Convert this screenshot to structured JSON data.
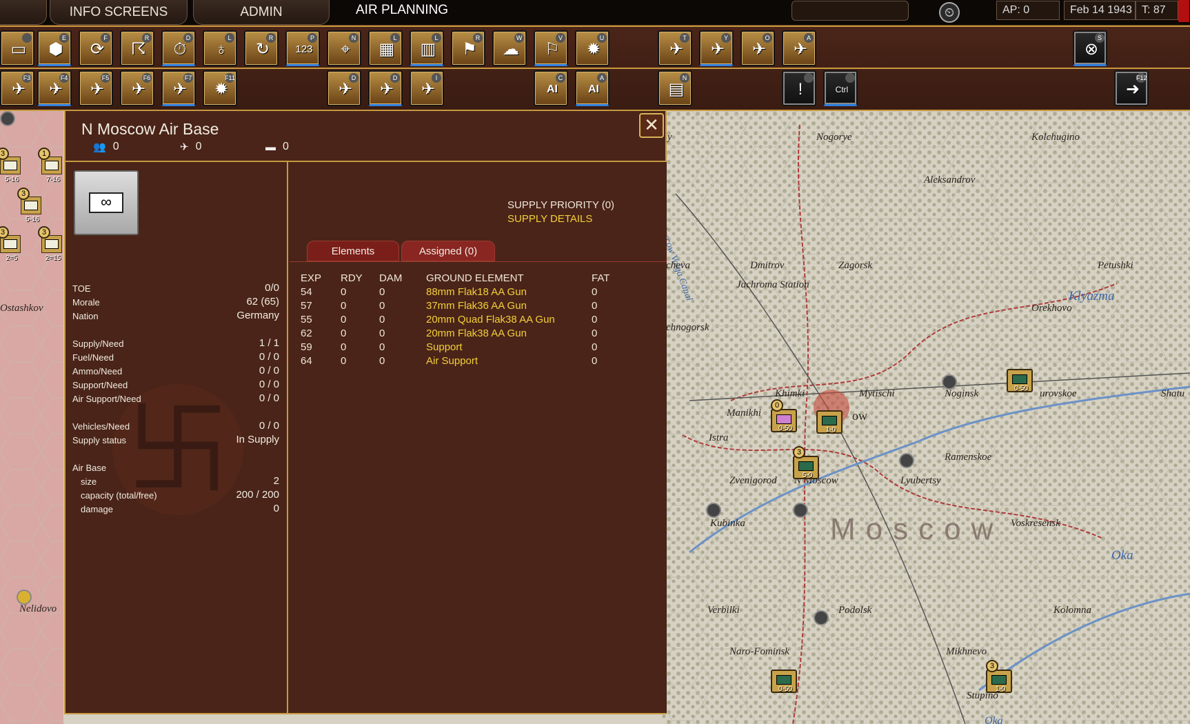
{
  "topbar": {
    "tab_current": "O",
    "tab_info": "INFO SCREENS",
    "tab_admin": "ADMIN",
    "title": "AIR PLANNING",
    "ap": "AP: 0",
    "date": "Feb 14 1943",
    "turn": "T: 87"
  },
  "toolbar": {
    "row1_keys": [
      "",
      "E",
      "F",
      "R",
      "D",
      "L",
      "R",
      "P",
      "N",
      "L",
      "L",
      "R",
      "W",
      "V",
      "U",
      "T",
      "Y",
      "O",
      "A",
      "S"
    ],
    "row2_keys": [
      "F3",
      "F4",
      "F5",
      "F6",
      "F7",
      "F11",
      "D",
      "D",
      "I",
      "C",
      "A",
      "N",
      "",
      "",
      "F12"
    ],
    "row1_icons": [
      "▭",
      "⬢",
      "⟳",
      "☈",
      "⏱",
      "♁",
      "↻",
      "123",
      "⌖",
      "▦",
      "▥",
      "⚑",
      "☁",
      "⚐",
      "✹",
      "✈",
      "✈",
      "✈",
      "✈",
      "⊗"
    ],
    "row2_icons": [
      "✈",
      "✈",
      "✈",
      "✈",
      "✈",
      "✹",
      "✈",
      "✈",
      "✈",
      "AI",
      "AI",
      "▤",
      "!",
      "Ctrl",
      "➜"
    ]
  },
  "panel": {
    "title": "N Moscow Air Base",
    "men": "0",
    "planes": "0",
    "vehicles": "0",
    "unit_symbol": "∞",
    "stats": {
      "toe_label": "TOE",
      "toe": "0/0",
      "morale_label": "Morale",
      "morale": "62 (65)",
      "nation_label": "Nation",
      "nation": "Germany",
      "supply_label": "Supply/Need",
      "supply": "1 / 1",
      "fuel_label": "Fuel/Need",
      "fuel": "0 / 0",
      "ammo_label": "Ammo/Need",
      "ammo": "0 / 0",
      "support_label": "Support/Need",
      "support": "0 / 0",
      "air_support_label": "Air Support/Need",
      "air_support": "0 / 0",
      "vehicles_label": "Vehicles/Need",
      "vehicles": "0 / 0",
      "supply_status_label": "Supply status",
      "supply_status": "In Supply",
      "air_base_label": "Air Base",
      "size_label": "size",
      "size": "2",
      "capacity_label": "capacity (total/free)",
      "capacity": "200 / 200",
      "damage_label": "damage",
      "damage": "0"
    },
    "supply_priority": "SUPPLY PRIORITY (0)",
    "supply_details": "SUPPLY DETAILS",
    "tabs": [
      "Elements",
      "Assigned (0)"
    ],
    "table": {
      "headers": [
        "EXP",
        "RDY",
        "DAM",
        "GROUND ELEMENT",
        "FAT"
      ],
      "rows": [
        [
          "54",
          "0",
          "0",
          "88mm Flak18 AA Gun",
          "0"
        ],
        [
          "57",
          "0",
          "0",
          "37mm Flak36 AA Gun",
          "0"
        ],
        [
          "55",
          "0",
          "0",
          "20mm Quad Flak38 AA Gun",
          "0"
        ],
        [
          "62",
          "0",
          "0",
          "20mm Flak38 AA Gun",
          "0"
        ],
        [
          "59",
          "0",
          "0",
          "Support",
          "0"
        ],
        [
          "64",
          "0",
          "0",
          "Air Support",
          "0"
        ]
      ]
    }
  },
  "map": {
    "labels": [
      "Nogorye",
      "Kolchugino",
      "Aleksandrov",
      "Dmitrov",
      "Zagorsk",
      "Petushki",
      "Jachroma Station",
      "Orekhovo",
      "chnogorsk",
      "Khimki",
      "Mytischi",
      "Noginsk",
      "urovskoe",
      "Shatu",
      "Manikhi",
      "Istra",
      "Ramenskoe",
      "Zvenigorod",
      "N Moscow",
      "Lyubertsy",
      "Kubinka",
      "Voskresensk",
      "Oka",
      "Verbilki",
      "Podolsk",
      "Kolomna",
      "Naro-Fominsk",
      "Mikhnevo",
      "Stupino",
      "Ostashkov",
      "Nelidovo",
      "Oka",
      "Moscow Volga Canal",
      "Klyazma",
      "cheva",
      "ow",
      "y"
    ],
    "big_label": "Moscow",
    "units": [
      "0-50",
      "1-0",
      "5-0",
      "0-50",
      "0-50",
      "1-0"
    ],
    "unit_levels": [
      "0",
      "",
      "3",
      "",
      "",
      "3"
    ],
    "left_units": [
      "5-16",
      "7-16",
      "5-16",
      "2=5",
      "2=15"
    ],
    "left_levels": [
      "3",
      "1",
      "3",
      "3",
      "3"
    ]
  },
  "colors": {
    "panel_bg": "#4a2418",
    "gold_border": "#c89a40",
    "highlight_text": "#f3cf3a"
  }
}
